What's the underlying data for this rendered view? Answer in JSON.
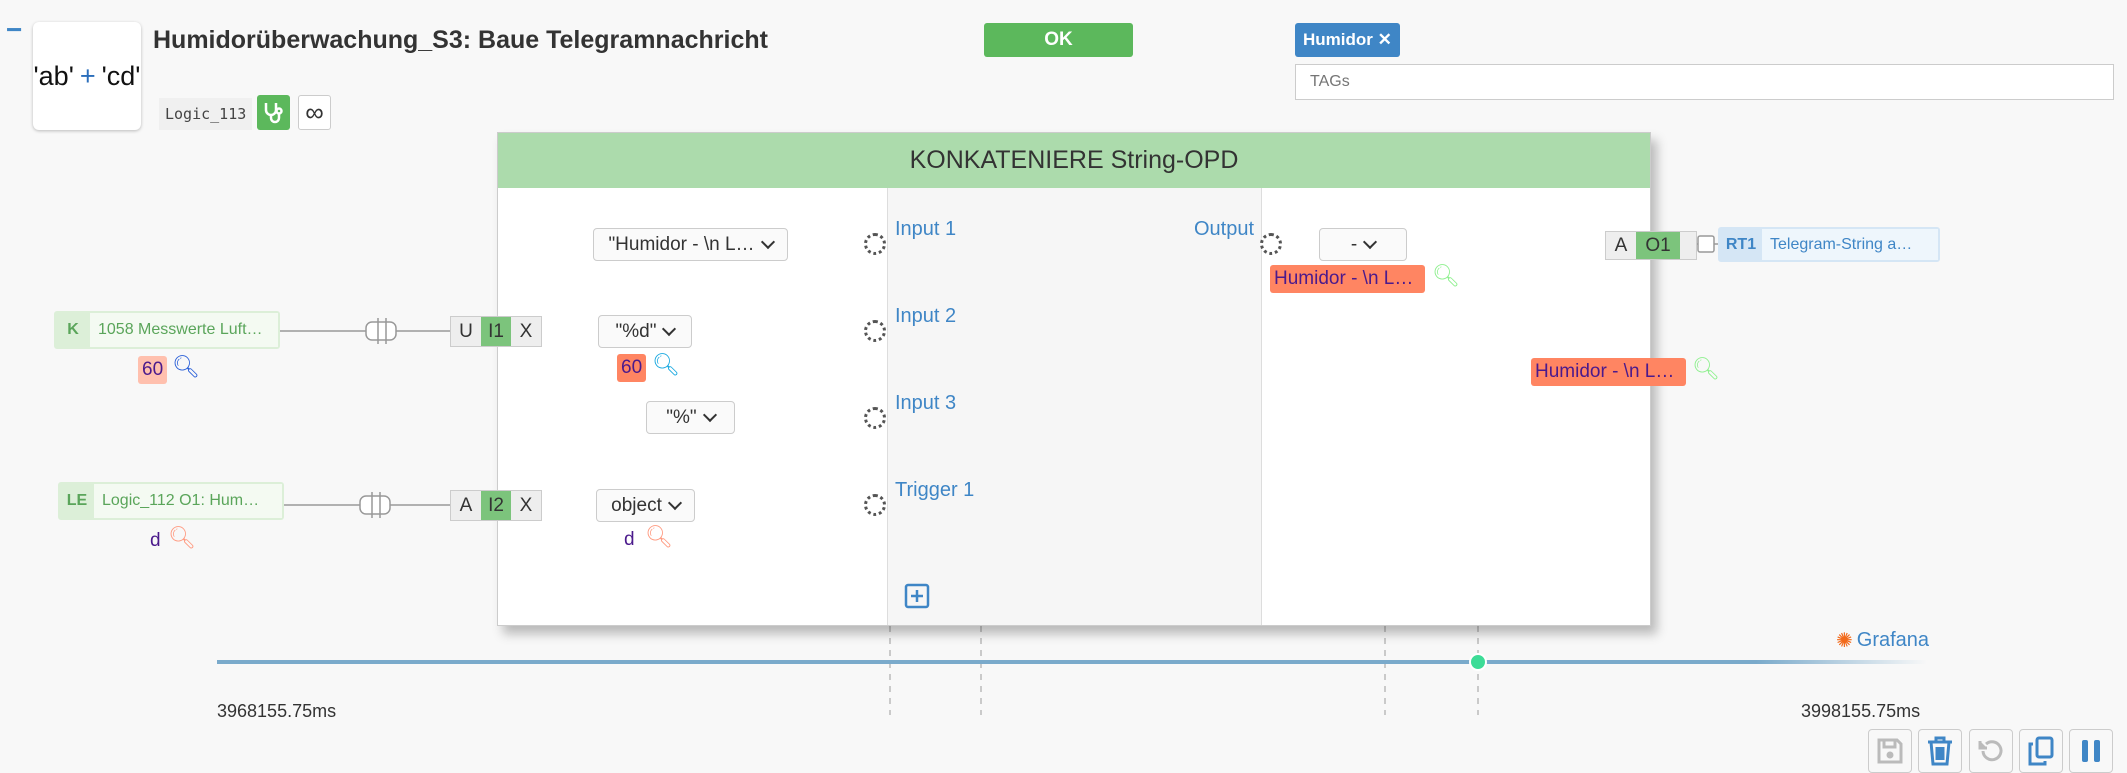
{
  "header": {
    "collapse_label": "−",
    "icon_left": "'ab'",
    "icon_op": "+",
    "icon_right": "'cd'",
    "title": "Humidorüberwachung_S3: Baue Telegramnachricht",
    "logic_id": "Logic_113",
    "ok_label": "OK",
    "tag_label": "Humidor",
    "tags_placeholder": "TAGs"
  },
  "block": {
    "title": "KONKATENIERE String-OPD",
    "inputs": [
      {
        "label": "Input 1",
        "value": "\"Humidor - \\n L…"
      },
      {
        "label": "Input 2",
        "value": "\"%d\"",
        "live": "60"
      },
      {
        "label": "Input 3",
        "value": "\"%\""
      },
      {
        "label": "Trigger 1",
        "value": "object",
        "live": "d"
      }
    ],
    "output": {
      "label": "Output",
      "value": "-",
      "live": "Humidor - \\n L…"
    }
  },
  "sources": [
    {
      "kind": "K",
      "name": "1058 Messwerte Luft…",
      "value": "60",
      "port": [
        "U",
        "I1",
        "X"
      ]
    },
    {
      "kind": "LE",
      "name": "Logic_112 O1: Hum…",
      "value": "d",
      "port": [
        "A",
        "I2",
        "X"
      ]
    }
  ],
  "target": {
    "kind": "RT1",
    "name": "Telegram-String a…",
    "port": [
      "A",
      "O1"
    ],
    "value": "Humidor - \\n L…"
  },
  "timeline": {
    "start": "3968155.75ms",
    "end": "3998155.75ms",
    "link": "Grafana"
  },
  "colors": {
    "accent": "#3f86c6",
    "ok": "#5cb85c",
    "header": "#acdbac",
    "badge": "#ff8562"
  }
}
